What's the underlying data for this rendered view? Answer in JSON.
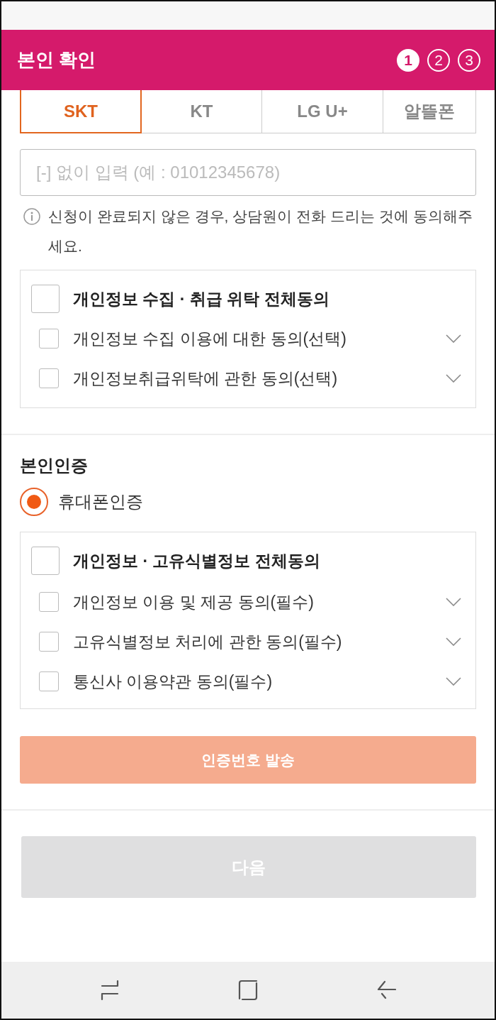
{
  "header": {
    "title": "본인 확인",
    "steps": [
      {
        "label": "1",
        "selected": true
      },
      {
        "label": "2",
        "selected": false
      },
      {
        "label": "3",
        "selected": false
      }
    ]
  },
  "carrier_tabs": [
    {
      "label": "SKT",
      "selected": true
    },
    {
      "label": "KT",
      "selected": false
    },
    {
      "label": "LG U+",
      "selected": false
    },
    {
      "label": "알뜰폰",
      "selected": false
    }
  ],
  "phone_field": {
    "placeholder": "[-] 없이 입력 (예 : 01012345678)"
  },
  "notice": "신청이 완료되지 않은 경우, 상담원이 전화 드리는 것에 동의해주세요.",
  "consent": {
    "all": {
      "label": "개인정보 수집 · 취급 위탁 전체동의",
      "checked": false
    },
    "items": [
      {
        "label": "개인정보 수집 이용에 대한 동의(선택)",
        "checked": false
      },
      {
        "label": "개인정보취급위탁에 관한 동의(선택)",
        "checked": false
      }
    ]
  },
  "verification": {
    "title": "본인인증",
    "methods": [
      {
        "label": "휴대폰인증",
        "selected": true
      }
    ],
    "consent": {
      "all": {
        "label": "개인정보 · 고유식별정보 전체동의",
        "checked": false
      },
      "items": [
        {
          "label": "개인정보 이용 및 제공 동의(필수)",
          "checked": false
        },
        {
          "label": "고유식별정보 처리에 관한 동의(필수)",
          "checked": false
        },
        {
          "label": "통신사 이용약관 동의(필수)",
          "checked": false
        }
      ]
    },
    "send_button": {
      "label": "인증번호 발송",
      "disabled": true
    }
  },
  "next_button": {
    "label": "다음",
    "disabled": true
  }
}
